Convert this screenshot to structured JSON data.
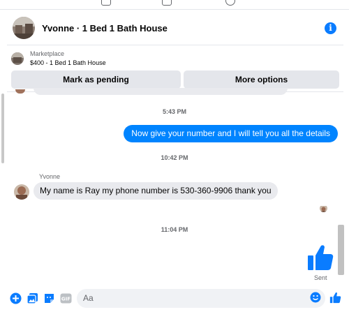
{
  "header": {
    "title": "Yvonne · 1 Bed 1 Bath House"
  },
  "listing": {
    "marketplace_label": "Marketplace",
    "price_title": "$400 - 1 Bed 1 Bath House",
    "mark_pending_label": "Mark as pending",
    "more_options_label": "More options"
  },
  "messages": {
    "ts1": "5:43 PM",
    "outgoing1": "Now give your number and I will tell you all the details",
    "ts2": "10:42 PM",
    "sender_name": "Yvonne",
    "incoming1": "My name is Ray my phone number is 530-360-9906 thank you",
    "ts3": "11:04 PM",
    "sent_status": "Sent"
  },
  "composer": {
    "placeholder": "Aa"
  },
  "colors": {
    "accent": "#0084ff",
    "icon_blue": "#0a7cff",
    "bubble_in": "#e9eaee"
  },
  "icons": [
    "info-icon",
    "plus-icon",
    "photo-icon",
    "sticker-icon",
    "gif-icon",
    "emoji-icon",
    "thumbs-up-icon"
  ]
}
